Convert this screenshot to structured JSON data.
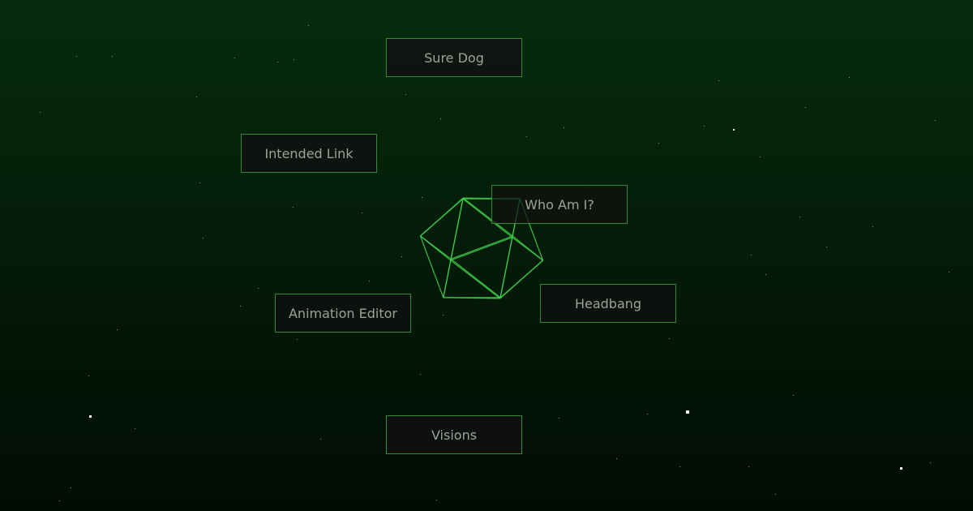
{
  "colors": {
    "background_top": "#062c0d",
    "background_bottom": "#020c04",
    "wireframe": "#3fcf4a",
    "button_border": "#2f8a3a",
    "button_text": "#9aa39a"
  },
  "centerpiece": {
    "icon": "wireframe-polyhedron-icon",
    "shape": "icosahedron"
  },
  "menu": {
    "items": [
      {
        "label": "Sure Dog"
      },
      {
        "label": "Intended Link"
      },
      {
        "label": "Who Am I?"
      },
      {
        "label": "Headbang"
      },
      {
        "label": "Animation Editor"
      },
      {
        "label": "Visions"
      }
    ]
  }
}
